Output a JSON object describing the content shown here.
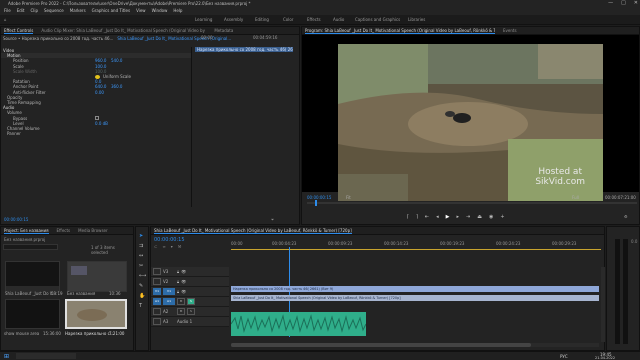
{
  "window": {
    "title": "Adobe Premiere Pro 2022 - C:\\Пользователи\\user\\OneDrive\\Документы\\Adobe\\Premiere Pro\\22.0\\Без названия.prproj *",
    "controls": [
      "—",
      "□",
      "✕"
    ]
  },
  "menu": [
    "File",
    "Edit",
    "Clip",
    "Sequence",
    "Markers",
    "Graphics and Titles",
    "View",
    "Window",
    "Help"
  ],
  "workspaces": [
    "Learning",
    "Assembly",
    "Editing",
    "Color",
    "Effects",
    "Audio",
    "Captions and Graphics",
    "Libraries"
  ],
  "effect_controls": {
    "tabs": [
      "Effect Controls",
      "Audio Clip Mixer: Shia LaBeouf _Just Do It_ Motivational Speech (Original Video by LaBeouf, Rönkkö & Turner) [720p]",
      "Metadata"
    ],
    "source": "Source • Нарезка прикольно со 2008 год. часть 46...",
    "sequence": "Shia LaBeouf _Just Do It_ Motivational Speech (Original...",
    "ruler_start": "00:00",
    "ruler_mid": "00:04:59:16",
    "clip_label": "Нарезка прикольно со 2008 год. часть 46( 2661) (Вит 9)",
    "section_video": "Video",
    "section_motion": "Motion",
    "position_label": "Position",
    "position_x": "960.0",
    "position_y": "540.0",
    "scale_label": "Scale",
    "scale_value": "100.0",
    "scale_width_label": "Scale Width",
    "scale_width_value": "100.0",
    "uniform_scale_label": "Uniform Scale",
    "rotation_label": "Rotation",
    "rotation_value": "0.0",
    "anchor_label": "Anchor Point",
    "anchor_x": "640.0",
    "anchor_y": "360.0",
    "antiflicker_label": "Anti-flicker Filter",
    "antiflicker_value": "0.00",
    "opacity_label": "Opacity",
    "time_remap_label": "Time Remapping",
    "section_audio": "Audio",
    "volume_label": "Volume",
    "bypass_label": "Bypass",
    "level_label": "Level",
    "level_value": "0.0 dB",
    "channel_volume_label": "Channel Volume",
    "panner_label": "Panner",
    "timecode": "00:00:00:15"
  },
  "program_monitor": {
    "tab_label": "Program: Shia LaBeouf _Just Do It_ Motivational Speech (Original Video by LaBeouf, Rönkkö & Turner) [720p]",
    "tab_extra": "Events",
    "watermark_line1": "Hosted at",
    "watermark_line2": "SikVid.com",
    "timecode": "00:00:00:15",
    "fit": "Fit",
    "quality": "Full",
    "duration": "00:00:07:21:00"
  },
  "project_panel": {
    "tabs": [
      "Project: Без названия",
      "Effects",
      "Media Browser"
    ],
    "project_file": "Без названия.prproj",
    "items_count": "1 of 3 items selected",
    "item1_name": "Shia LaBeouf _Just Do It...",
    "item1_duration": "59:19",
    "item2_name": "Без названия",
    "item2_duration": "10:36",
    "item3_name": "Нарезка прикольно с...",
    "item3_duration": "7:21:00",
    "item4_name": "show mouse area",
    "item4_duration": "15:36:00"
  },
  "timeline": {
    "tab_label": "Shia LaBeouf _Just Do It_ Motivational Speech (Original Video by LaBeouf, Rönkkö & Turner) [720p]",
    "timecode": "00:00:00:15",
    "ruler": [
      "00:00",
      "00:00:04:23",
      "00:00:09:23",
      "00:00:14:23",
      "00:00:19:23",
      "00:00:24:23",
      "00:00:29:23"
    ],
    "tracks": [
      "V3",
      "V2",
      "V1",
      "A1",
      "A2",
      "A3"
    ],
    "track_labels": [
      "V1",
      "A1"
    ],
    "clip_v2": "Нарезка прикольно со 2008 год. часть 46( 2661) (Вит 9)",
    "clip_v1": "Shia LaBeouf _Just Do It_ Motivational Speech (Original Video by LaBeouf, Rönkkö & Turner) [720p]",
    "audio_label": "Audio 1",
    "audio_db": "0.0"
  },
  "taskbar": {
    "lang": "РУС",
    "time": "19:45",
    "date": "21.04.2022"
  },
  "colors": {
    "accent": "#2d8ceb",
    "video_clip": "#8ea7d8",
    "audio_clip": "#2fae8a",
    "timecode": "#2d8ceb"
  }
}
